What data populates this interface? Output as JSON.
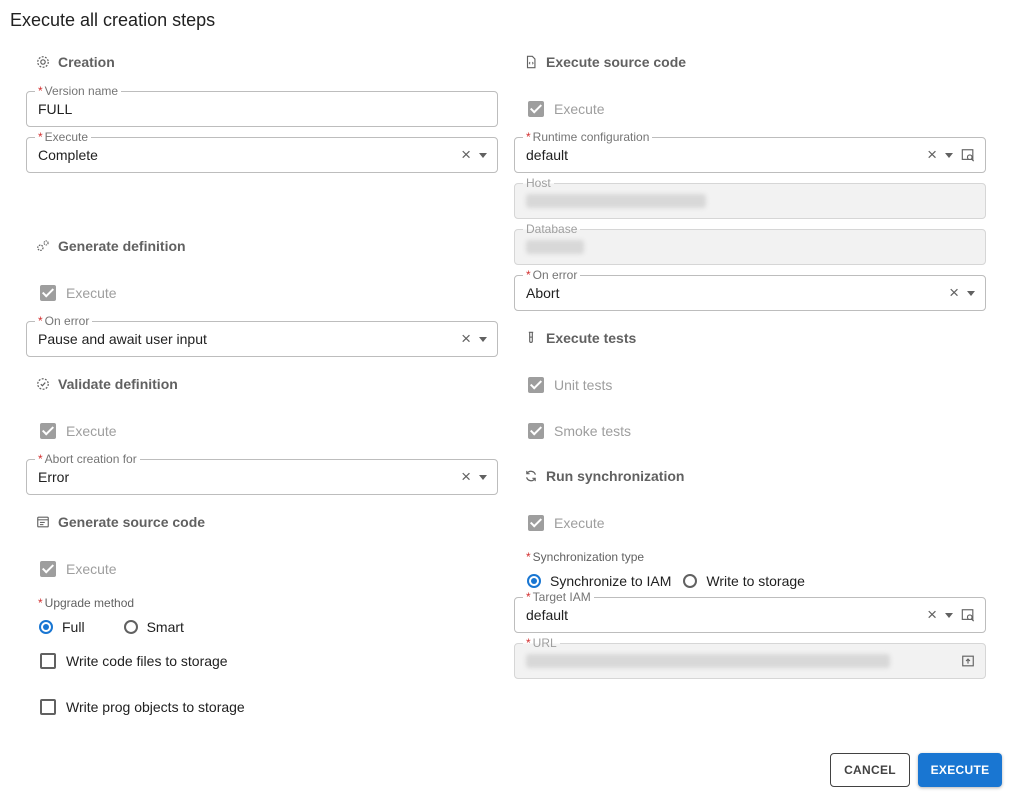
{
  "dialog": {
    "title": "Execute all creation steps"
  },
  "sections": {
    "creation": "Creation",
    "generate_definition": "Generate definition",
    "validate_definition": "Validate definition",
    "generate_source_code": "Generate source code",
    "execute_source_code": "Execute source code",
    "execute_tests": "Execute tests",
    "run_synchronization": "Run synchronization"
  },
  "required_mark": "*",
  "creation": {
    "version_name": {
      "label": "Version name",
      "value": "FULL"
    },
    "execute": {
      "label": "Execute",
      "value": "Complete"
    }
  },
  "generate_definition": {
    "execute_label": "Execute",
    "execute_checked": true,
    "on_error": {
      "label": "On error",
      "value": "Pause and await user input"
    }
  },
  "validate_definition": {
    "execute_label": "Execute",
    "execute_checked": true,
    "abort_creation_for": {
      "label": "Abort creation for",
      "value": "Error"
    }
  },
  "generate_source_code": {
    "execute_label": "Execute",
    "execute_checked": true,
    "upgrade_method": {
      "label": "Upgrade method",
      "options": [
        "Full",
        "Smart"
      ],
      "selected": "Full"
    },
    "write_code_files": {
      "label": "Write code files to storage",
      "checked": false
    },
    "write_prog_objects": {
      "label": "Write prog objects to storage",
      "checked": false
    }
  },
  "execute_source_code": {
    "execute_label": "Execute",
    "execute_checked": true,
    "runtime_configuration": {
      "label": "Runtime configuration",
      "value": "default"
    },
    "host": {
      "label": "Host"
    },
    "database": {
      "label": "Database"
    },
    "on_error": {
      "label": "On error",
      "value": "Abort"
    }
  },
  "execute_tests": {
    "unit_tests": {
      "label": "Unit tests",
      "checked": true
    },
    "smoke_tests": {
      "label": "Smoke tests",
      "checked": true
    }
  },
  "run_synchronization": {
    "execute_label": "Execute",
    "execute_checked": true,
    "synchronization_type": {
      "label": "Synchronization type",
      "options": [
        "Synchronize to IAM",
        "Write to storage"
      ],
      "selected": "Synchronize to IAM"
    },
    "target_iam": {
      "label": "Target IAM",
      "value": "default"
    },
    "url": {
      "label": "URL"
    }
  },
  "icons": {
    "clear": "close-icon",
    "dropdown": "arrow-drop-down-icon",
    "lookup": "search-window-icon",
    "upload": "upload-icon"
  },
  "footer": {
    "cancel": "CANCEL",
    "execute": "EXECUTE"
  },
  "colors": {
    "primary": "#1976d2",
    "required": "#d32f2f",
    "disabled_fill": "#f2f2f2",
    "section_text": "#616161"
  }
}
